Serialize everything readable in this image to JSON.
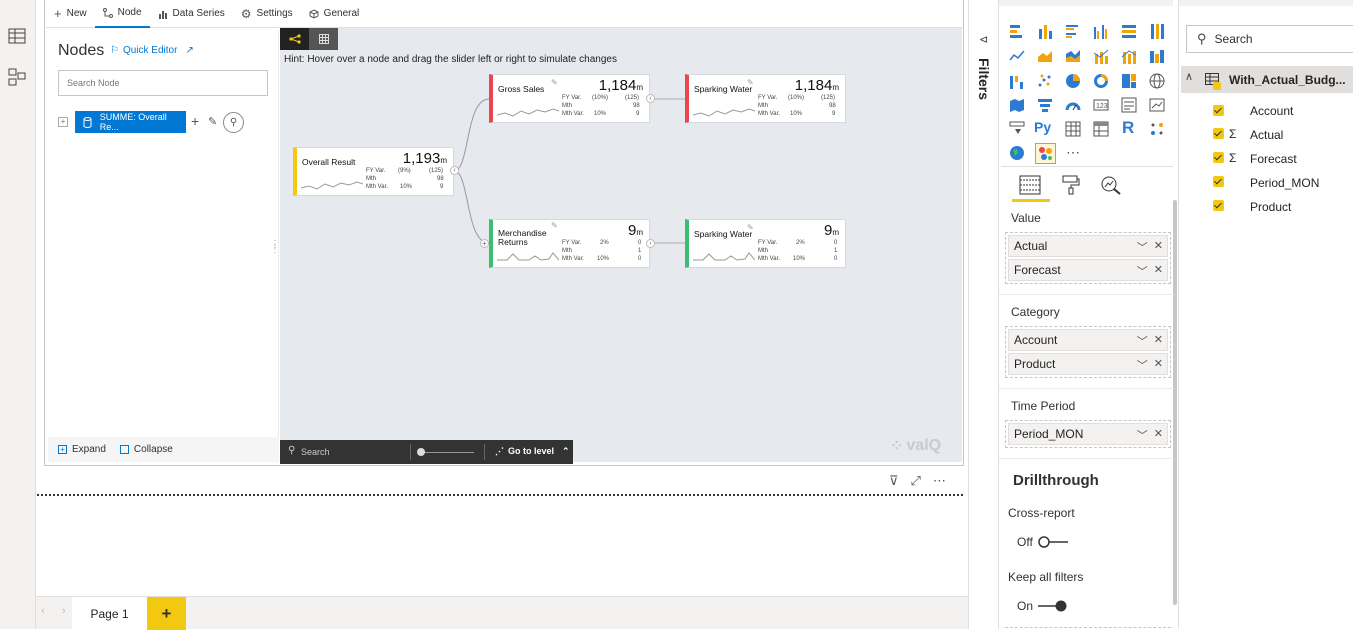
{
  "tabs": {
    "new": "New",
    "node": "Node",
    "data_series": "Data Series",
    "settings": "Settings",
    "general": "General"
  },
  "nodes_panel": {
    "title": "Nodes",
    "quick_editor": "Quick Editor",
    "search_placeholder": "Search Node",
    "tree_item": "SUMME: Overall Re...",
    "expand": "Expand",
    "collapse": "Collapse"
  },
  "canvas": {
    "hint": "Hint: Hover over a node and drag the slider left or right to simulate changes",
    "cards": {
      "overall": {
        "name": "Overall Result",
        "value": "1,193",
        "unit": "m",
        "r1l": "FY Var.",
        "r1a": "(9%)",
        "r1b": "(125)",
        "r2l": "Mth",
        "r2b": "98",
        "r3l": "Mth Var.",
        "r3a": "10%",
        "r3b": "9"
      },
      "gross": {
        "name": "Gross Sales",
        "value": "1,184",
        "unit": "m",
        "r1l": "FY Var.",
        "r1a": "(10%)",
        "r1b": "(125)",
        "r2l": "Mth",
        "r2b": "98",
        "r3l": "Mth Var.",
        "r3a": "10%",
        "r3b": "9"
      },
      "sparking1": {
        "name": "Sparking Water",
        "value": "1,184",
        "unit": "m",
        "r1l": "FY Var.",
        "r1a": "(10%)",
        "r1b": "(125)",
        "r2l": "Mth",
        "r2b": "98",
        "r3l": "Mth Var.",
        "r3a": "10%",
        "r3b": "9"
      },
      "merch": {
        "name1": "Merchandise",
        "name2": "Returns",
        "value": "9",
        "unit": "m",
        "r1l": "FY Var.",
        "r1a": "2%",
        "r1b": "0",
        "r2l": "Mth",
        "r2b": "1",
        "r3l": "Mth Var.",
        "r3a": "10%",
        "r3b": "0"
      },
      "sparking2": {
        "name": "Sparking Water",
        "value": "9",
        "unit": "m",
        "r1l": "FY Var.",
        "r1a": "2%",
        "r1b": "0",
        "r2l": "Mth",
        "r2b": "1",
        "r3l": "Mth Var.",
        "r3a": "10%",
        "r3b": "0"
      }
    },
    "search": "Search",
    "goto": "Go to level",
    "brand": "valQ"
  },
  "pages": {
    "page1": "Page 1",
    "add": "+"
  },
  "filters_label": "Filters",
  "viz": {
    "value_label": "Value",
    "value_fields": [
      "Actual",
      "Forecast"
    ],
    "category_label": "Category",
    "category_fields": [
      "Account",
      "Product"
    ],
    "time_label": "Time Period",
    "time_fields": [
      "Period_MON"
    ],
    "drillthrough": "Drillthrough",
    "cross_report": "Cross-report",
    "cross_state": "Off",
    "keep_filters": "Keep all filters",
    "keep_state": "On"
  },
  "fields": {
    "search": "Search",
    "table": "With_Actual_Budg...",
    "items": [
      "Account",
      "Actual",
      "Forecast",
      "Period_MON",
      "Product"
    ]
  },
  "colors": {
    "accent": "#0078d4",
    "yellow": "#f2c811",
    "red": "#e8474f",
    "green": "#3dbd72"
  }
}
